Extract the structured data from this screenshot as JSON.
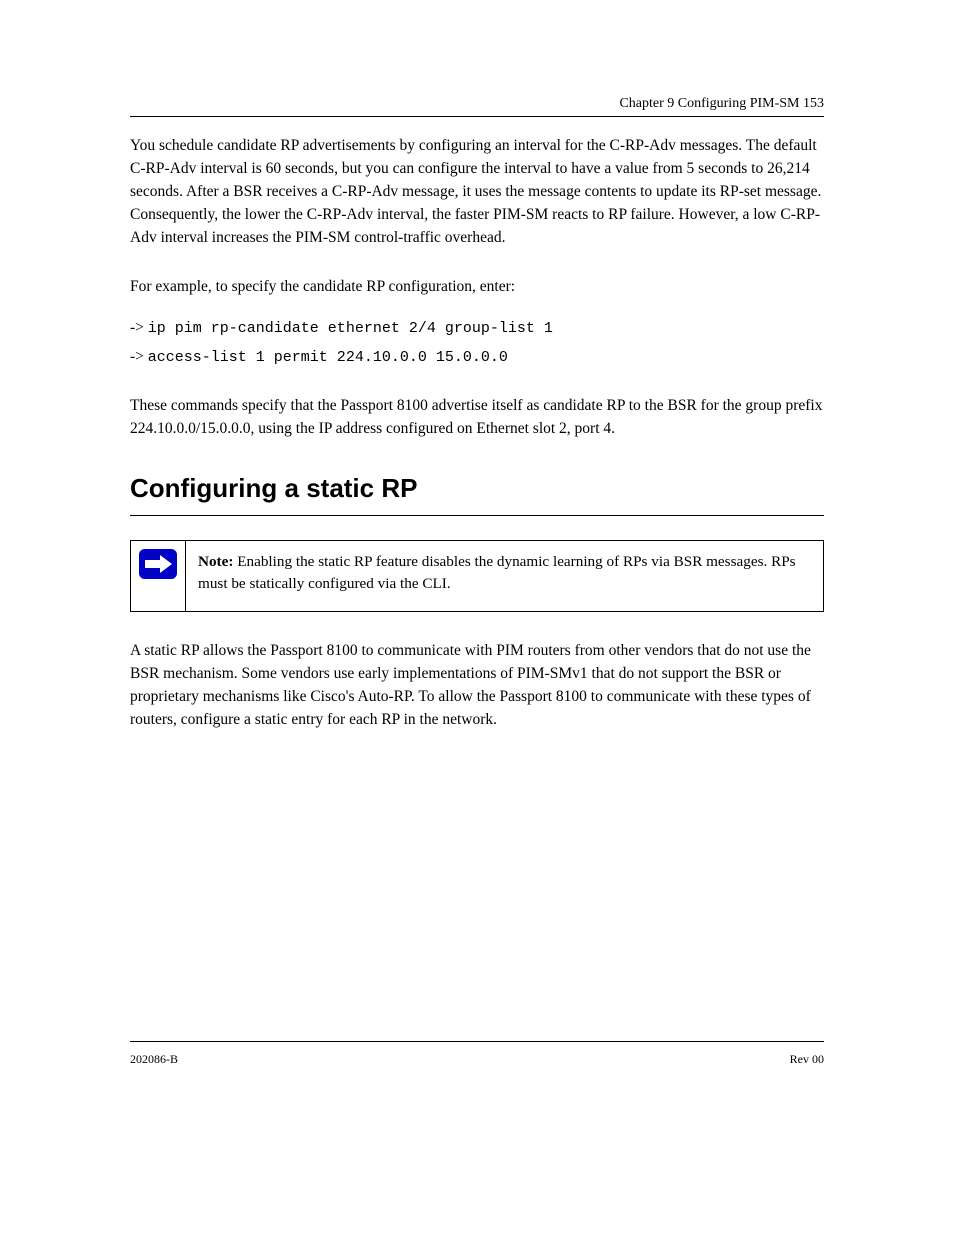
{
  "runhead": "Chapter 9 Configuring PIM-SM 153",
  "paragraphs": {
    "p1": "You schedule candidate RP advertisements by configuring an interval for the C-RP-Adv messages. The default C-RP-Adv interval is 60 seconds, but you can configure the interval to have a value from 5 seconds to 26,214 seconds. After a BSR receives a C-RP-Adv message, it uses the message contents to update its RP-set message. Consequently, the lower the C-RP-Adv interval, the faster PIM-SM reacts to RP failure. However, a low C-RP-Adv interval increases the PIM-SM control-traffic overhead.",
    "exLabel": "For example, to specify the candidate RP configuration, enter:",
    "ex1_pre": "->",
    "ex1": "ip pim rp-candidate ethernet 2/4 group-list 1",
    "ex2_pre": "->",
    "ex2": "access-list 1 permit 224.10.0.0 15.0.0.0",
    "p2": "These commands specify that the Passport 8100 advertise itself as candidate RP to the BSR for the group prefix 224.10.0.0/15.0.0.0, using the IP address configured on Ethernet slot 2, port 4."
  },
  "section": {
    "title": "Configuring a static RP",
    "noteLabel": "Note:",
    "noteBody": " Enabling the static RP feature disables the dynamic learning of RPs via BSR messages. RPs must be statically configured via the CLI.",
    "p3": "A static RP allows the Passport 8100 to communicate with PIM routers from other vendors that do not use the BSR mechanism. Some vendors use early implementations of PIM-SMv1 that do not support the BSR or proprietary mechanisms like Cisco's Auto-RP. To allow the Passport 8100 to communicate with these types of routers, configure a static entry for each RP in the network."
  },
  "footer": {
    "left": "202086-B",
    "right": "Rev 00"
  }
}
